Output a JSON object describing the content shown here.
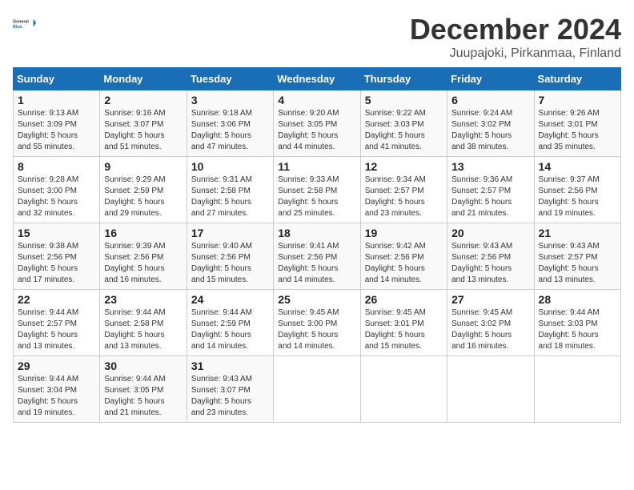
{
  "logo": {
    "line1": "General",
    "line2": "Blue"
  },
  "title": "December 2024",
  "subtitle": "Juupajoki, Pirkanmaa, Finland",
  "header": {
    "save_label": "December 2024",
    "location_label": "Juupajoki, Pirkanmaa, Finland"
  },
  "columns": [
    "Sunday",
    "Monday",
    "Tuesday",
    "Wednesday",
    "Thursday",
    "Friday",
    "Saturday"
  ],
  "weeks": [
    [
      {
        "day": "1",
        "sunrise": "9:13 AM",
        "sunset": "3:09 PM",
        "daylight": "5 hours and 55 minutes."
      },
      {
        "day": "2",
        "sunrise": "9:16 AM",
        "sunset": "3:07 PM",
        "daylight": "5 hours and 51 minutes."
      },
      {
        "day": "3",
        "sunrise": "9:18 AM",
        "sunset": "3:06 PM",
        "daylight": "5 hours and 47 minutes."
      },
      {
        "day": "4",
        "sunrise": "9:20 AM",
        "sunset": "3:05 PM",
        "daylight": "5 hours and 44 minutes."
      },
      {
        "day": "5",
        "sunrise": "9:22 AM",
        "sunset": "3:03 PM",
        "daylight": "5 hours and 41 minutes."
      },
      {
        "day": "6",
        "sunrise": "9:24 AM",
        "sunset": "3:02 PM",
        "daylight": "5 hours and 38 minutes."
      },
      {
        "day": "7",
        "sunrise": "9:26 AM",
        "sunset": "3:01 PM",
        "daylight": "5 hours and 35 minutes."
      }
    ],
    [
      {
        "day": "8",
        "sunrise": "9:28 AM",
        "sunset": "3:00 PM",
        "daylight": "5 hours and 32 minutes."
      },
      {
        "day": "9",
        "sunrise": "9:29 AM",
        "sunset": "2:59 PM",
        "daylight": "5 hours and 29 minutes."
      },
      {
        "day": "10",
        "sunrise": "9:31 AM",
        "sunset": "2:58 PM",
        "daylight": "5 hours and 27 minutes."
      },
      {
        "day": "11",
        "sunrise": "9:33 AM",
        "sunset": "2:58 PM",
        "daylight": "5 hours and 25 minutes."
      },
      {
        "day": "12",
        "sunrise": "9:34 AM",
        "sunset": "2:57 PM",
        "daylight": "5 hours and 23 minutes."
      },
      {
        "day": "13",
        "sunrise": "9:36 AM",
        "sunset": "2:57 PM",
        "daylight": "5 hours and 21 minutes."
      },
      {
        "day": "14",
        "sunrise": "9:37 AM",
        "sunset": "2:56 PM",
        "daylight": "5 hours and 19 minutes."
      }
    ],
    [
      {
        "day": "15",
        "sunrise": "9:38 AM",
        "sunset": "2:56 PM",
        "daylight": "5 hours and 17 minutes."
      },
      {
        "day": "16",
        "sunrise": "9:39 AM",
        "sunset": "2:56 PM",
        "daylight": "5 hours and 16 minutes."
      },
      {
        "day": "17",
        "sunrise": "9:40 AM",
        "sunset": "2:56 PM",
        "daylight": "5 hours and 15 minutes."
      },
      {
        "day": "18",
        "sunrise": "9:41 AM",
        "sunset": "2:56 PM",
        "daylight": "5 hours and 14 minutes."
      },
      {
        "day": "19",
        "sunrise": "9:42 AM",
        "sunset": "2:56 PM",
        "daylight": "5 hours and 14 minutes."
      },
      {
        "day": "20",
        "sunrise": "9:43 AM",
        "sunset": "2:56 PM",
        "daylight": "5 hours and 13 minutes."
      },
      {
        "day": "21",
        "sunrise": "9:43 AM",
        "sunset": "2:57 PM",
        "daylight": "5 hours and 13 minutes."
      }
    ],
    [
      {
        "day": "22",
        "sunrise": "9:44 AM",
        "sunset": "2:57 PM",
        "daylight": "5 hours and 13 minutes."
      },
      {
        "day": "23",
        "sunrise": "9:44 AM",
        "sunset": "2:58 PM",
        "daylight": "5 hours and 13 minutes."
      },
      {
        "day": "24",
        "sunrise": "9:44 AM",
        "sunset": "2:59 PM",
        "daylight": "5 hours and 14 minutes."
      },
      {
        "day": "25",
        "sunrise": "9:45 AM",
        "sunset": "3:00 PM",
        "daylight": "5 hours and 14 minutes."
      },
      {
        "day": "26",
        "sunrise": "9:45 AM",
        "sunset": "3:01 PM",
        "daylight": "5 hours and 15 minutes."
      },
      {
        "day": "27",
        "sunrise": "9:45 AM",
        "sunset": "3:02 PM",
        "daylight": "5 hours and 16 minutes."
      },
      {
        "day": "28",
        "sunrise": "9:44 AM",
        "sunset": "3:03 PM",
        "daylight": "5 hours and 18 minutes."
      }
    ],
    [
      {
        "day": "29",
        "sunrise": "9:44 AM",
        "sunset": "3:04 PM",
        "daylight": "5 hours and 19 minutes."
      },
      {
        "day": "30",
        "sunrise": "9:44 AM",
        "sunset": "3:05 PM",
        "daylight": "5 hours and 21 minutes."
      },
      {
        "day": "31",
        "sunrise": "9:43 AM",
        "sunset": "3:07 PM",
        "daylight": "5 hours and 23 minutes."
      },
      null,
      null,
      null,
      null
    ]
  ]
}
